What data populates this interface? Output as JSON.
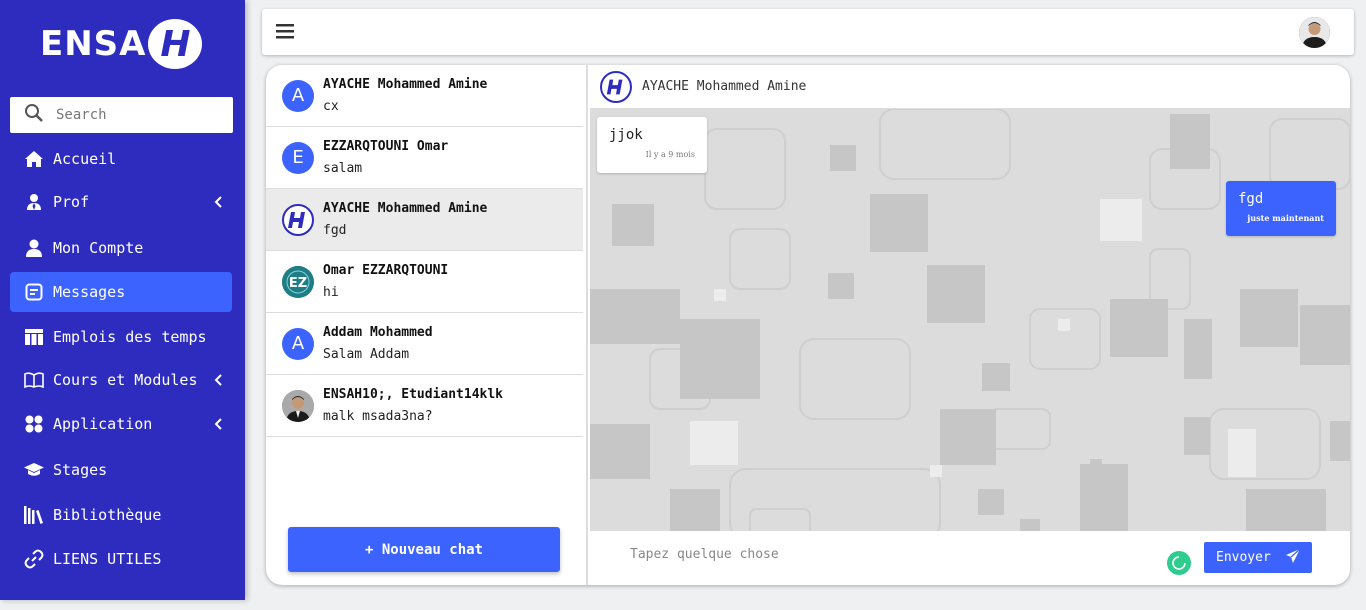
{
  "brand": {
    "text": "ENSA",
    "mark": "H"
  },
  "search": {
    "placeholder": "Search",
    "icon": "search-icon"
  },
  "sidebar": {
    "items": [
      {
        "label": "Accueil",
        "icon": "home-icon"
      },
      {
        "label": "Prof",
        "icon": "user-tie-icon",
        "has_submenu": true
      },
      {
        "label": "Mon Compte",
        "icon": "user-icon"
      },
      {
        "label": "Messages",
        "icon": "message-icon",
        "active": true
      },
      {
        "label": "Emplois des temps",
        "icon": "table-icon"
      },
      {
        "label": "Cours et Modules",
        "icon": "book-icon",
        "has_submenu": true
      },
      {
        "label": "Application",
        "icon": "apps-icon",
        "has_submenu": true
      },
      {
        "label": "Stages",
        "icon": "graduation-cap-icon"
      },
      {
        "label": "Bibliothèque",
        "icon": "library-icon"
      },
      {
        "label": "LIENS UTILES",
        "icon": "link-icon"
      }
    ]
  },
  "topbar": {
    "menu_icon": "hamburger-icon",
    "avatar": "user-avatar"
  },
  "conversations": [
    {
      "name": "AYACHE Mohammed Amine",
      "last_message": "cx",
      "avatar_letter": "A",
      "avatar_type": "letter"
    },
    {
      "name": "EZZARQTOUNI Omar",
      "last_message": "salam",
      "avatar_letter": "E",
      "avatar_type": "letter"
    },
    {
      "name": "AYACHE Mohammed Amine",
      "last_message": "fgd",
      "avatar_type": "logo",
      "selected": true
    },
    {
      "name": "Omar EZZARQTOUNI",
      "last_message": "hi",
      "avatar_type": "ez-logo"
    },
    {
      "name": "Addam Mohammed",
      "last_message": "Salam Addam",
      "avatar_letter": "A",
      "avatar_type": "letter"
    },
    {
      "name": "ENSAH10;, Etudiant14klk",
      "last_message": "malk msada3na?",
      "avatar_type": "photo"
    }
  ],
  "new_chat_label": "+ Nouveau chat",
  "chat": {
    "title": "AYACHE Mohammed Amine",
    "messages": [
      {
        "direction": "in",
        "text": "jjok",
        "time": "Il y a 9 mois"
      },
      {
        "direction": "out",
        "text": "fgd",
        "time": "juste maintenant"
      }
    ],
    "input_placeholder": "Tapez quelque chose",
    "send_label": "Envoyer"
  },
  "colors": {
    "sidebar": "#2e2cbf",
    "accent": "#3d63ff",
    "chat_bg": "#dcdcdc",
    "status": "#2ecc8f"
  }
}
